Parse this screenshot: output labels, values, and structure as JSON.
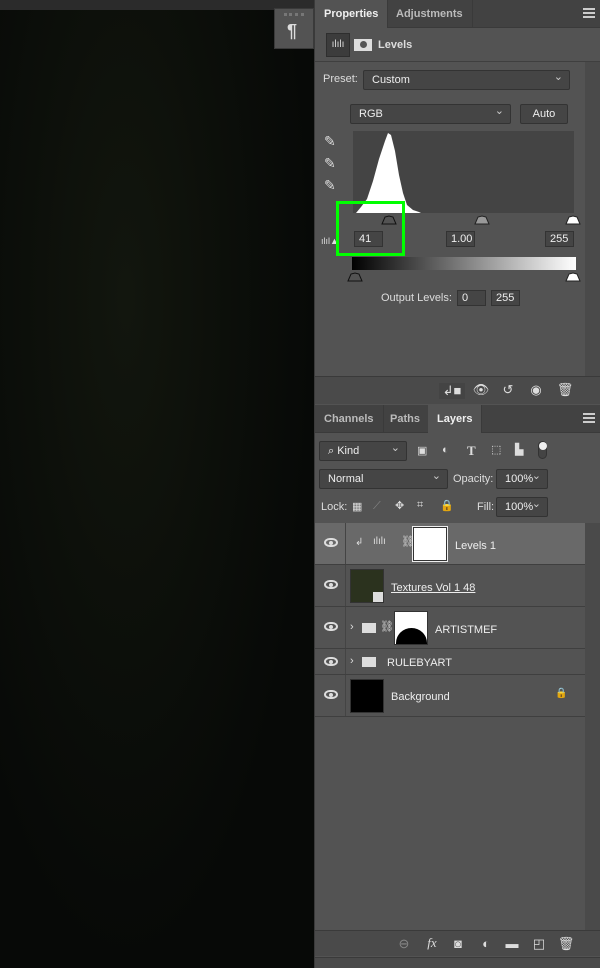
{
  "properties_panel": {
    "tabs": [
      {
        "label": "Properties",
        "active": true
      },
      {
        "label": "Adjustments",
        "active": false
      }
    ],
    "adjustment_title": "Levels",
    "preset_label": "Preset:",
    "preset_value": "Custom",
    "channel_value": "RGB",
    "auto_label": "Auto",
    "input_levels": {
      "black": "41",
      "gamma": "1.00",
      "white": "255"
    },
    "output_levels_label": "Output Levels:",
    "output_levels": {
      "black": "0",
      "white": "255"
    },
    "highlight_color": "#00ff00"
  },
  "layers_panel": {
    "tabs": [
      {
        "label": "Channels",
        "active": false
      },
      {
        "label": "Paths",
        "active": false
      },
      {
        "label": "Layers",
        "active": true
      }
    ],
    "filter_kind": "Kind",
    "blend_mode": "Normal",
    "opacity_label": "Opacity:",
    "opacity_value": "100%",
    "lock_label": "Lock:",
    "fill_label": "Fill:",
    "fill_value": "100%",
    "layers": [
      {
        "name": "Levels 1",
        "selected": true,
        "type": "adjustment"
      },
      {
        "name": "Textures Vol 1 48",
        "type": "smart-object"
      },
      {
        "name": "ARTISTMEF",
        "type": "group"
      },
      {
        "name": "RULEBYART",
        "type": "group"
      },
      {
        "name": "Background",
        "type": "background",
        "locked": true
      }
    ]
  },
  "side_panel": {
    "icon": "paragraph-icon"
  }
}
